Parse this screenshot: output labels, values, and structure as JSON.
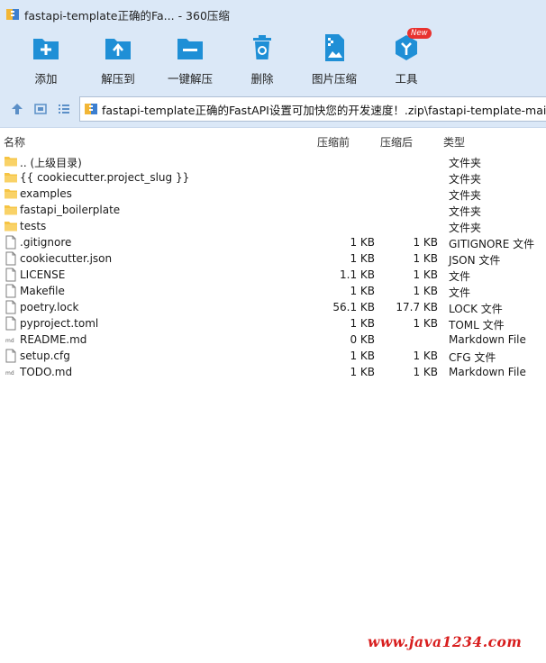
{
  "window": {
    "title": "fastapi-template正确的Fa... - 360压缩"
  },
  "toolbar": {
    "items": [
      {
        "label": "添加",
        "icon": "add-icon"
      },
      {
        "label": "解压到",
        "icon": "extract-to-icon"
      },
      {
        "label": "一键解压",
        "icon": "one-click-extract-icon"
      },
      {
        "label": "删除",
        "icon": "trash-icon"
      },
      {
        "label": "图片压缩",
        "icon": "image-compress-icon"
      },
      {
        "label": "工具",
        "icon": "tools-icon",
        "badge": "New"
      }
    ]
  },
  "address": {
    "path": "fastapi-template正确的FastAPI设置可加快您的开发速度！.zip\\fastapi-template-main - 解"
  },
  "columns": {
    "name": "名称",
    "size": "压缩前",
    "packed": "压缩后",
    "type": "类型"
  },
  "files": [
    {
      "name": ".. (上级目录)",
      "size": "",
      "packed": "",
      "type": "文件夹",
      "icon": "folder-icon"
    },
    {
      "name": "{{ cookiecutter.project_slug }}",
      "size": "",
      "packed": "",
      "type": "文件夹",
      "icon": "folder-icon"
    },
    {
      "name": "examples",
      "size": "",
      "packed": "",
      "type": "文件夹",
      "icon": "folder-icon"
    },
    {
      "name": "fastapi_boilerplate",
      "size": "",
      "packed": "",
      "type": "文件夹",
      "icon": "folder-icon"
    },
    {
      "name": "tests",
      "size": "",
      "packed": "",
      "type": "文件夹",
      "icon": "folder-icon"
    },
    {
      "name": ".gitignore",
      "size": "1 KB",
      "packed": "1 KB",
      "type": "GITIGNORE 文件",
      "icon": "file-icon"
    },
    {
      "name": "cookiecutter.json",
      "size": "1 KB",
      "packed": "1 KB",
      "type": "JSON 文件",
      "icon": "file-icon"
    },
    {
      "name": "LICENSE",
      "size": "1.1 KB",
      "packed": "1 KB",
      "type": "文件",
      "icon": "file-icon"
    },
    {
      "name": "Makefile",
      "size": "1 KB",
      "packed": "1 KB",
      "type": "文件",
      "icon": "file-icon"
    },
    {
      "name": "poetry.lock",
      "size": "56.1 KB",
      "packed": "17.7 KB",
      "type": "LOCK 文件",
      "icon": "file-icon"
    },
    {
      "name": "pyproject.toml",
      "size": "1 KB",
      "packed": "1 KB",
      "type": "TOML 文件",
      "icon": "file-icon"
    },
    {
      "name": "README.md",
      "size": "0 KB",
      "packed": "",
      "type": "Markdown File",
      "icon": "markdown-icon"
    },
    {
      "name": "setup.cfg",
      "size": "1 KB",
      "packed": "1 KB",
      "type": "CFG 文件",
      "icon": "file-icon"
    },
    {
      "name": "TODO.md",
      "size": "1 KB",
      "packed": "1 KB",
      "type": "Markdown File",
      "icon": "markdown-icon"
    }
  ],
  "watermark": "www.java1234.com",
  "colors": {
    "chrome_bg": "#dbe8f7",
    "icon_blue": "#1f8fd6",
    "folder_yellow": "#f6c443",
    "badge_red": "#e8322f",
    "watermark_red": "#d81e1e"
  }
}
